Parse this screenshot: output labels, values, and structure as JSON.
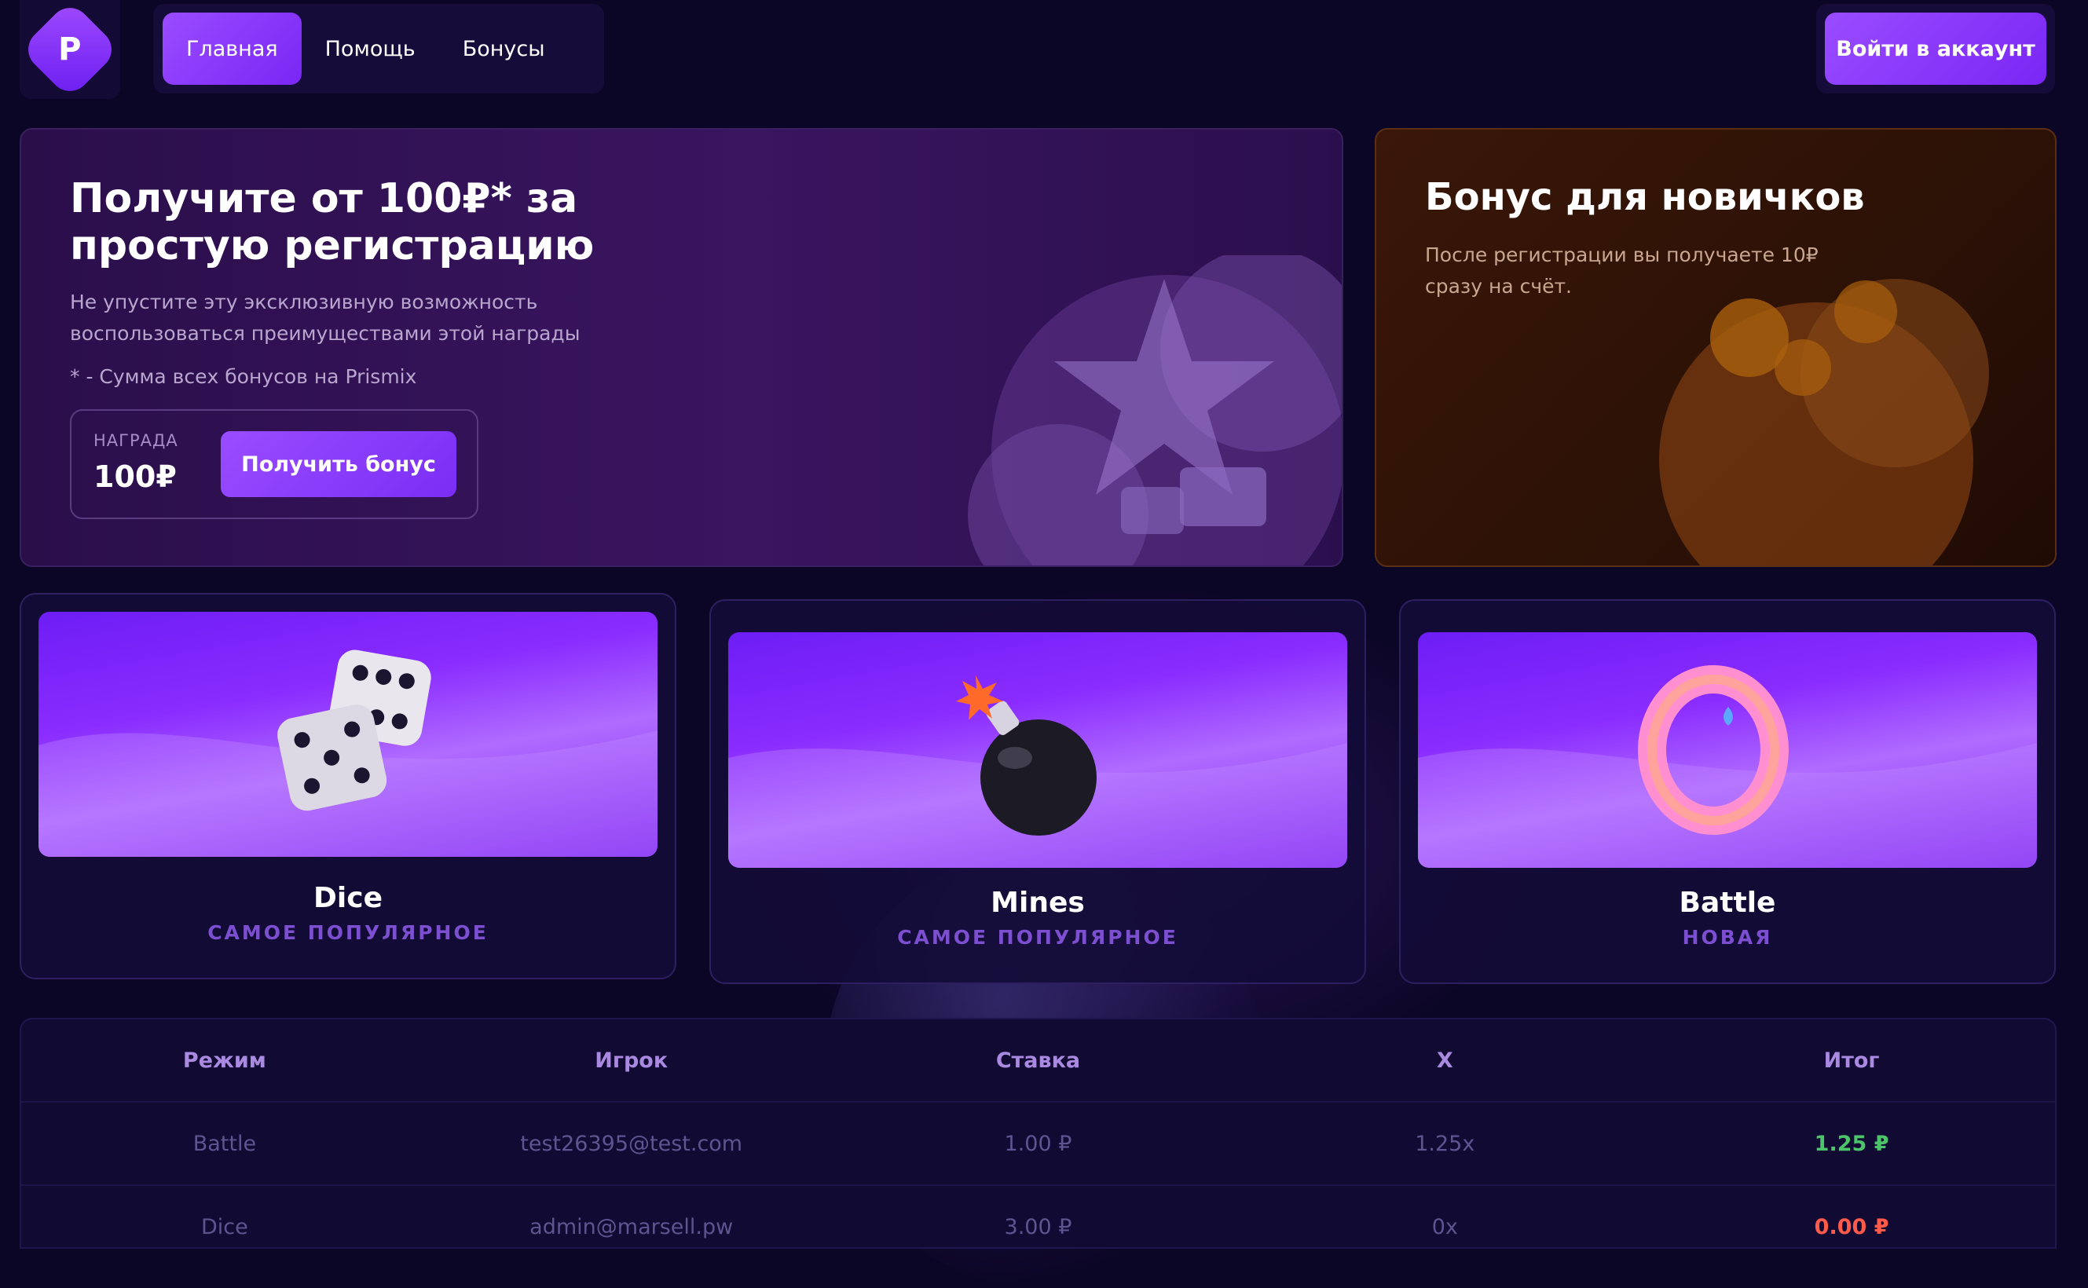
{
  "header": {
    "logo_letter": "P",
    "nav": [
      {
        "label": "Главная",
        "active": true
      },
      {
        "label": "Помощь",
        "active": false
      },
      {
        "label": "Бонусы",
        "active": false
      }
    ],
    "login_label": "Войти в аккаунт"
  },
  "promo": {
    "title": "Получите от 100₽* за простую регистрацию",
    "subtitle": "Не упустите эту эксклюзивную возможность воспользоваться преимуществами этой награды",
    "note": "* - Сумма всех бонусов на Prismix",
    "reward_label": "НАГРАДА",
    "reward_value": "100₽",
    "button_label": "Получить бонус"
  },
  "newbie": {
    "title": "Бонус для новичков",
    "description": "После регистрации вы получаете 10₽ сразу на счёт."
  },
  "games": [
    {
      "title": "Dice",
      "tag": "САМОЕ ПОПУЛЯРНОЕ",
      "icon": "dice-icon"
    },
    {
      "title": "Mines",
      "tag": "САМОЕ ПОПУЛЯРНОЕ",
      "icon": "bomb-icon"
    },
    {
      "title": "Battle",
      "tag": "НОВАЯ",
      "icon": "ring-icon"
    }
  ],
  "table": {
    "columns": [
      "Режим",
      "Игрок",
      "Ставка",
      "X",
      "Итог"
    ],
    "rows": [
      {
        "mode": "Battle",
        "player": "test26395@test.com",
        "bet": "1.00 ₽",
        "x": "1.25x",
        "result": "1.25 ₽",
        "status": "win"
      },
      {
        "mode": "Dice",
        "player": "admin@marsell.pw",
        "bet": "3.00 ₽",
        "x": "0x",
        "result": "0.00 ₽",
        "status": "loss"
      }
    ]
  },
  "colors": {
    "accent": "#8a3cff",
    "win": "#4cc56a",
    "loss": "#ff5a4a",
    "background": "#0c0626"
  }
}
